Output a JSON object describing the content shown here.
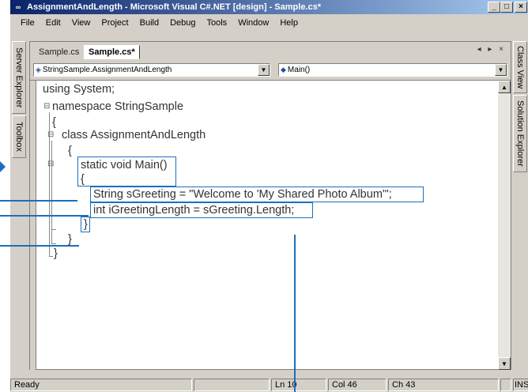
{
  "window": {
    "title": "AssignmentAndLength - Microsoft Visual C#.NET [design] - Sample.cs*",
    "app_icon": "vs-icon",
    "controls": [
      "_",
      "□",
      "×"
    ]
  },
  "menu": {
    "items": [
      {
        "label": "File",
        "underline": "F"
      },
      {
        "label": "Edit",
        "underline": "E"
      },
      {
        "label": "View",
        "underline": "V"
      },
      {
        "label": "Project",
        "underline": "P"
      },
      {
        "label": "Build",
        "underline": "B"
      },
      {
        "label": "Debug",
        "underline": "D"
      },
      {
        "label": "Tools",
        "underline": "T"
      },
      {
        "label": "Window",
        "underline": "W"
      },
      {
        "label": "Help",
        "underline": "H"
      }
    ]
  },
  "left_panels": [
    "Server Explorer",
    "Toolbox"
  ],
  "right_panels": [
    "Class View",
    "Solution Explorer"
  ],
  "tabs": {
    "items": [
      "Sample.cs",
      "Sample.cs*"
    ],
    "active": "Sample.cs*",
    "nav_arrows": "◂ ▸ ×"
  },
  "nav": {
    "type_combo": "StringSample.AssignmentAndLength",
    "member_combo": "Main()"
  },
  "code": {
    "lines": [
      "using System;",
      "namespace StringSample",
      "{",
      "class AssignmentAndLength",
      "{",
      "static void Main()",
      "{",
      "String sGreeting = \"Welcome to 'My Shared Photo Album'\";",
      "int iGreetingLength = sGreeting.Length;",
      "}",
      "}",
      "}"
    ]
  },
  "status": {
    "ready": "Ready",
    "line": "Ln 10",
    "col": "Col 46",
    "ch": "Ch 43",
    "mode": "INS"
  },
  "colors": {
    "callout": "#1a6fc0",
    "titlebar_start": "#0a246a",
    "titlebar_end": "#a6caf0"
  }
}
